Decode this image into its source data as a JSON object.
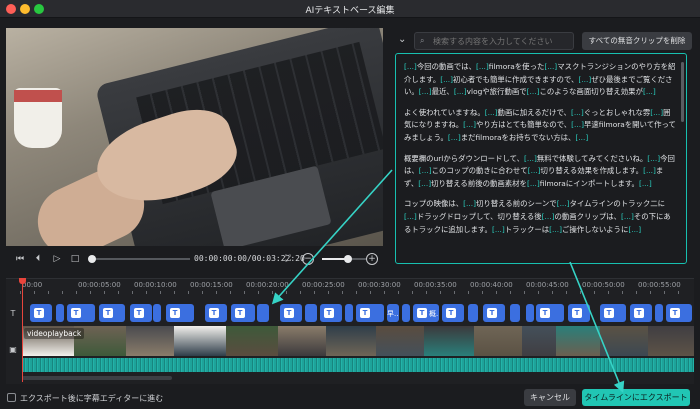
{
  "window": {
    "title": "AIテキストベース編集"
  },
  "player": {
    "timecode": "00:00:00:00/00:03:22:20"
  },
  "search": {
    "placeholder": "検索する内容を入力してください"
  },
  "toolbar": {
    "delete_silent_label": "すべての無音クリップを削除"
  },
  "transcript": {
    "paragraphs": [
      "[...]今回の動画では、[...]filmoraを使った[...]マスクトランジションのやり方を紹介します。[...]初心者でも簡単に作成できますので、[...]ぜひ最後までご覧ください。[...]最近、[...]vlogや旅行動画で[...]このような画面切り替え効果が[...]",
      "よく使われていますね。[...]動画に加えるだけで、[...]ぐっとおしゃれな雰[...]囲気になりますね。[...]やり方はとても簡単なので、[...]早速filmoraを開いて作ってみましょう。[...]まだfilmoraをお持ちでない方は、[...]",
      "概要欄のurlからダウンロードして、[...]無料で体験してみてくださいね。[...]今回は、[...]このコップの動きに合わせて[...]切り替える効果を作成します。[...]まず、[...]切り替える前後の動画素材を[...]filmoraにインポートします。[...]",
      "コップの映像は、[...]切り替える前のシーンで[...]タイムラインのトラック二に[...]ドラッグドロップして、切り替える後[...]の動画クリップは、[...]その下にあるトラックに追加します。[...]トラックーは[...]ご操作しないように[...]"
    ]
  },
  "timeline": {
    "ruler": [
      "00:00",
      "00:00:05:00",
      "00:00:10:00",
      "00:00:15:00",
      "00:00:20:00",
      "00:00:25:00",
      "00:00:30:00",
      "00:00:35:00",
      "00:00:40:00",
      "00:00:45:00",
      "00:00:50:00",
      "00:00:55:00"
    ],
    "video_clip_label": "videoplayback",
    "text_clip_glyph": "T",
    "text_clip_labels": [
      "早...",
      "概..."
    ]
  },
  "footer": {
    "checkbox_label": "エクスポート後に字幕エディターに進む",
    "cancel_label": "キャンセル",
    "export_label": "タイムラインにエクスポートする"
  },
  "colors": {
    "accent": "#21c6b4",
    "text_clip": "#3b6fe0",
    "playhead": "#e8453c",
    "audio": "#1ea39a"
  },
  "icons": [
    "search-icon",
    "chevron-down-icon",
    "skip-back-icon",
    "step-back-icon",
    "play-icon",
    "stop-icon",
    "fullscreen-icon",
    "zoom-out-icon",
    "zoom-in-icon",
    "text-track-icon",
    "video-track-icon"
  ]
}
